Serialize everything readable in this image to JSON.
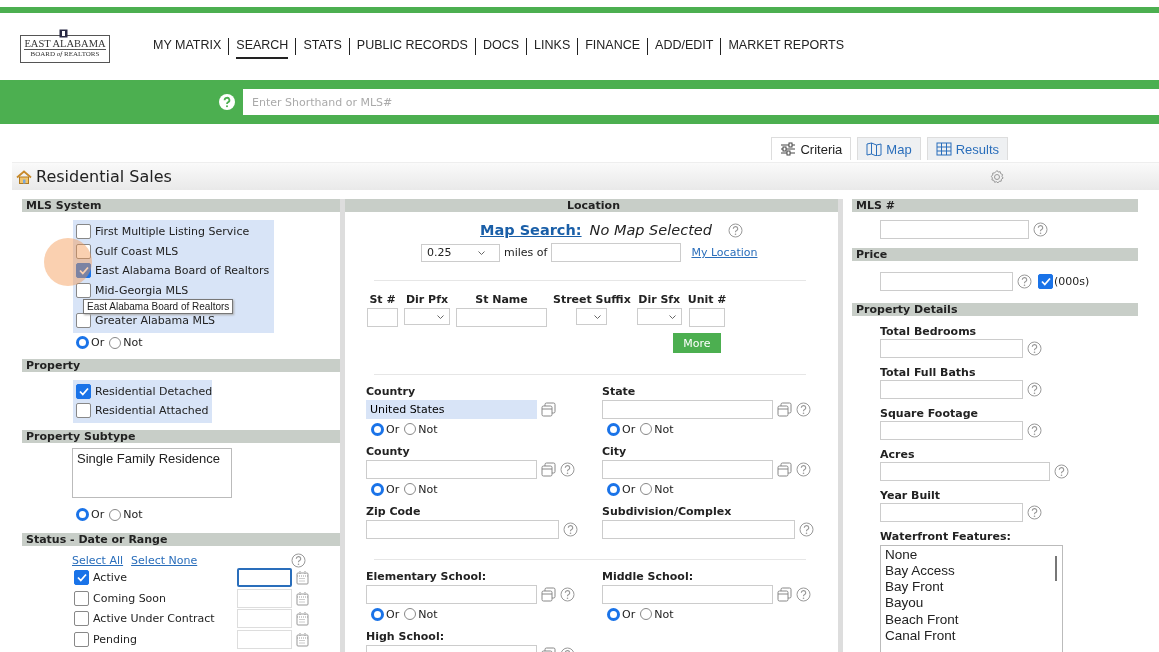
{
  "header": {
    "logo": {
      "line1": "EAST ALABAMA",
      "line2": "BOARD *of* REALTORS"
    },
    "nav": [
      {
        "label": "MY MATRIX",
        "selected": false
      },
      {
        "label": "SEARCH",
        "selected": true
      },
      {
        "label": "STATS",
        "selected": false
      },
      {
        "label": "PUBLIC RECORDS",
        "selected": false
      },
      {
        "label": "DOCS",
        "selected": false
      },
      {
        "label": "LINKS",
        "selected": false
      },
      {
        "label": "FINANCE",
        "selected": false
      },
      {
        "label": "ADD/EDIT",
        "selected": false
      },
      {
        "label": "MARKET REPORTS",
        "selected": false
      }
    ]
  },
  "quick_search": {
    "placeholder": "Enter Shorthand or MLS#"
  },
  "view_tabs": [
    {
      "label": "Criteria",
      "kind": "sliders",
      "selected": true
    },
    {
      "label": "Map",
      "kind": "map",
      "selected": false
    },
    {
      "label": "Results",
      "kind": "grid",
      "selected": false
    }
  ],
  "page_title": "Residential Sales",
  "click_indicator": true,
  "left": {
    "mls_system": {
      "title": "MLS System",
      "options": [
        {
          "label": "First Multiple Listing Service",
          "checked": false
        },
        {
          "label": "Gulf Coast MLS",
          "checked": false
        },
        {
          "label": "East Alabama Board of Realtors",
          "checked": true
        },
        {
          "label": "Mid-Georgia MLS",
          "checked": false
        },
        {
          "label": "Greater Alabama MLS",
          "checked": false
        }
      ],
      "tooltip": "East Alabama Board of Realtors",
      "radios": [
        {
          "label": "Or",
          "selected": true
        },
        {
          "label": "Not",
          "selected": false
        }
      ]
    },
    "property": {
      "title": "Property",
      "options": [
        {
          "label": "Residential Detached",
          "checked": true
        },
        {
          "label": "Residential Attached",
          "checked": false
        }
      ]
    },
    "subtype": {
      "title": "Property Subtype",
      "items": [
        "Single Family Residence"
      ],
      "radios": [
        {
          "label": "Or",
          "selected": true
        },
        {
          "label": "Not",
          "selected": false
        }
      ]
    },
    "status": {
      "title": "Status - Date or Range",
      "select_all": "Select All",
      "select_none": "Select None",
      "items": [
        {
          "label": "Active",
          "checked": true,
          "focused": true
        },
        {
          "label": "Coming Soon",
          "checked": false,
          "focused": false
        },
        {
          "label": "Active Under Contract",
          "checked": false,
          "focused": false
        },
        {
          "label": "Pending",
          "checked": false,
          "focused": false
        }
      ]
    }
  },
  "location": {
    "title": "Location",
    "map_search": "Map Search:",
    "map_status": "No Map Selected",
    "radius": "0.25",
    "miles_of": "miles of",
    "my_location": "My Location",
    "address": [
      {
        "label": "St #",
        "kind": "input"
      },
      {
        "label": "Dir Pfx",
        "kind": "select"
      },
      {
        "label": "St Name",
        "kind": "input"
      },
      {
        "label": "Street Suffix",
        "kind": "select"
      },
      {
        "label": "Dir Sfx",
        "kind": "select"
      },
      {
        "label": "Unit #",
        "kind": "input"
      }
    ],
    "more": "More",
    "groups": [
      [
        {
          "label": "Country",
          "value": "United States",
          "lookup": true,
          "help": false,
          "radios": [
            {
              "label": "Or",
              "selected": true
            },
            {
              "label": "Not",
              "selected": false
            }
          ]
        },
        {
          "label": "State",
          "lookup": true,
          "help": true,
          "radios": [
            {
              "label": "Or",
              "selected": true
            },
            {
              "label": "Not",
              "selected": false
            }
          ]
        },
        {
          "label": "County",
          "lookup": true,
          "help": true,
          "radios": [
            {
              "label": "Or",
              "selected": true
            },
            {
              "label": "Not",
              "selected": false
            }
          ]
        },
        {
          "label": "City",
          "lookup": true,
          "help": true,
          "radios": [
            {
              "label": "Or",
              "selected": true
            },
            {
              "label": "Not",
              "selected": false
            }
          ]
        },
        {
          "label": "Zip Code",
          "lookup": false,
          "help": true
        },
        {
          "label": "Subdivision/Complex",
          "lookup": false,
          "help": true
        }
      ],
      [
        {
          "label": "Elementary School:",
          "lookup": true,
          "help": true,
          "radios": [
            {
              "label": "Or",
              "selected": true
            },
            {
              "label": "Not",
              "selected": false
            }
          ]
        },
        {
          "label": "Middle School:",
          "lookup": true,
          "help": true,
          "radios": [
            {
              "label": "Or",
              "selected": true
            },
            {
              "label": "Not",
              "selected": false
            }
          ]
        },
        {
          "label": "High School:",
          "lookup": true,
          "help": true
        }
      ]
    ]
  },
  "right": {
    "mls_number": {
      "title": "MLS #"
    },
    "price": {
      "title": "Price",
      "thousands": {
        "label": "(000s)",
        "checked": true
      }
    },
    "details": {
      "title": "Property Details",
      "fields": [
        {
          "label": "Total Bedrooms"
        },
        {
          "label": "Total Full Baths"
        },
        {
          "label": "Square Footage"
        },
        {
          "label": "Acres"
        },
        {
          "label": "Year Built"
        }
      ],
      "waterfront": {
        "label": "Waterfront Features:",
        "items": [
          "None",
          "Bay Access",
          "Bay Front",
          "Bayou",
          "Beach Front",
          "Canal Front"
        ]
      }
    }
  }
}
